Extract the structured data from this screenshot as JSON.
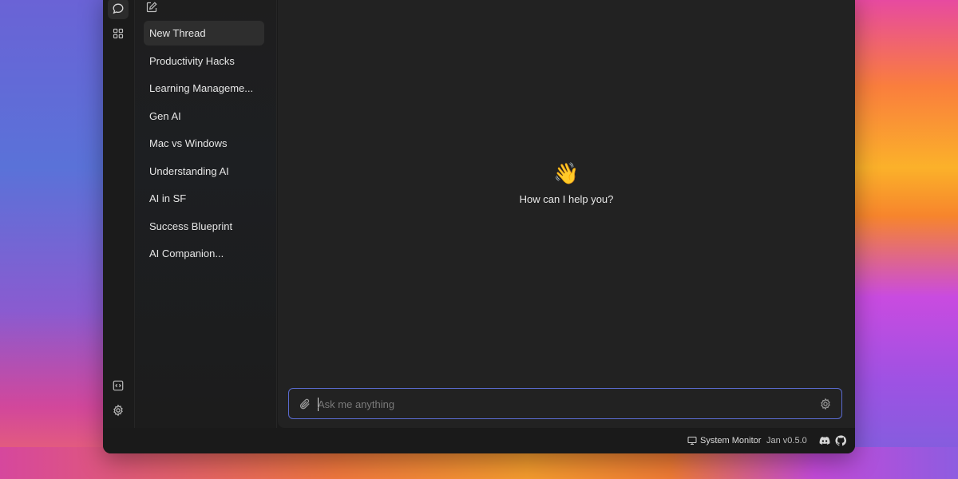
{
  "threads": {
    "items": [
      {
        "label": "New Thread",
        "active": true
      },
      {
        "label": "Productivity Hacks"
      },
      {
        "label": "Learning Manageme..."
      },
      {
        "label": "Gen AI"
      },
      {
        "label": "Mac vs Windows"
      },
      {
        "label": "Understanding AI"
      },
      {
        "label": "AI in SF"
      },
      {
        "label": "Success Blueprint"
      },
      {
        "label": "AI Companion..."
      }
    ]
  },
  "main": {
    "greeting_emoji": "👋",
    "greeting_text": "How can I help you?"
  },
  "composer": {
    "placeholder": "Ask me anything",
    "value": ""
  },
  "status_bar": {
    "system_monitor_label": "System Monitor",
    "version": "Jan v0.5.0"
  },
  "icons": {
    "rail_top": [
      "chat-icon",
      "grid-icon"
    ],
    "rail_bottom": [
      "code-icon",
      "gear-icon"
    ],
    "composer": [
      "paperclip-icon",
      "gear-icon"
    ],
    "status": [
      "monitor-icon",
      "discord-icon",
      "github-icon"
    ]
  },
  "colors": {
    "accent_border": "#5a6bd0",
    "window_bg": "#1a1a1a",
    "main_bg": "#222222",
    "active_item_bg": "#2e2e2e"
  }
}
